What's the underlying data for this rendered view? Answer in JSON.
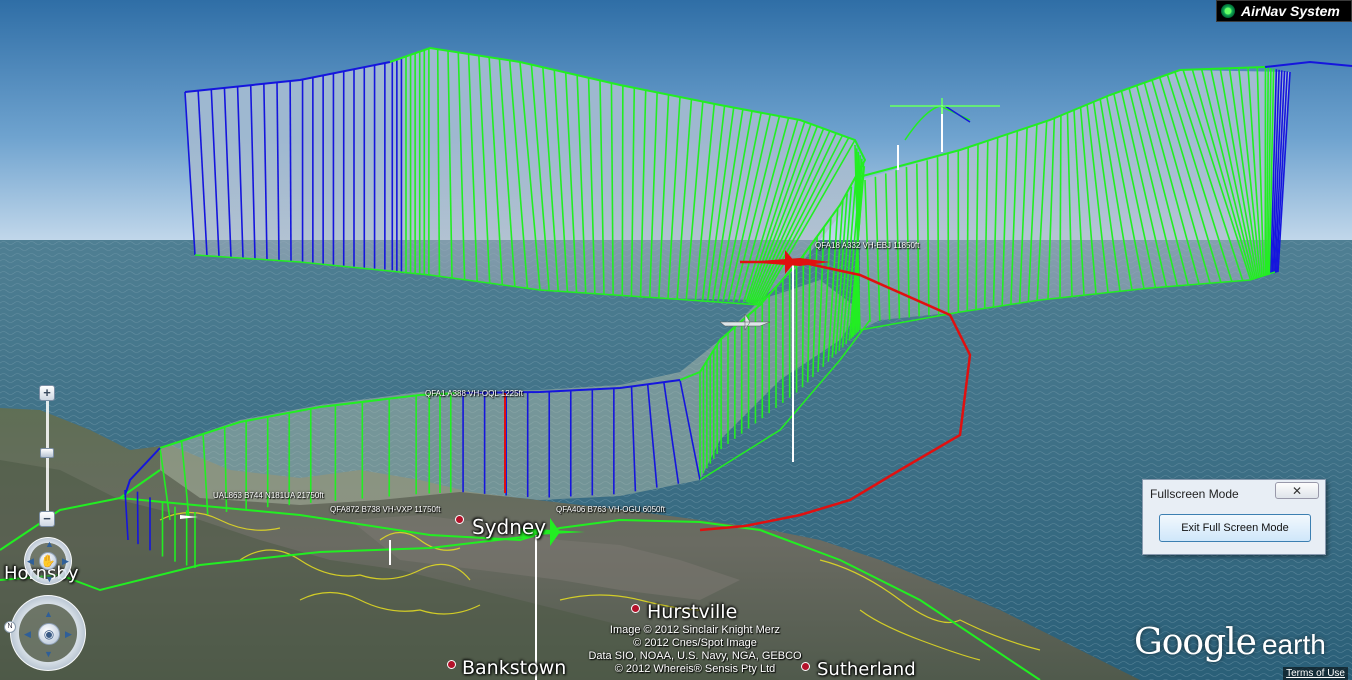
{
  "brand": {
    "airnav_text": "AirNav System"
  },
  "places": {
    "sydney": "Sydney",
    "hurstville": "Hurstville",
    "bankstown": "Bankstown",
    "sutherland": "Sutherland",
    "hornsby": "Hornsby"
  },
  "flights": [
    {
      "label": "UAL863 B744 N181UA 21750ft"
    },
    {
      "label": "QFA872 B738 VH-VXP 11750ft"
    },
    {
      "label": "QFA406 B763 VH-OGU 6050ft"
    },
    {
      "label": "QFA1 A388 VH-OQL 1225ft"
    },
    {
      "label": "QFA18 A332 VH-EBJ 11850ft"
    }
  ],
  "credits": [
    "Image © 2012 Sinclair Knight Merz",
    "© 2012 Cnes/Spot Image",
    "Data SIO, NOAA, U.S. Navy, NGA, GEBCO",
    "© 2012 Whereis® Sensis Pty Ltd"
  ],
  "logo": {
    "google": "Google",
    "earth": "earth"
  },
  "terms_link": "Terms of Use",
  "fullscreen_dialog": {
    "title": "Fullscreen Mode",
    "close_icon": "✕",
    "exit_button": "Exit Full Screen Mode"
  },
  "nav": {
    "zoom_in": "+",
    "zoom_out": "−",
    "look_icon": "hand-icon",
    "move_icon": "eye-icon"
  },
  "colors": {
    "track_green": "#22ee22",
    "track_blue": "#1515dd",
    "track_red": "#e01010",
    "coast_yellow": "#e8e020"
  }
}
